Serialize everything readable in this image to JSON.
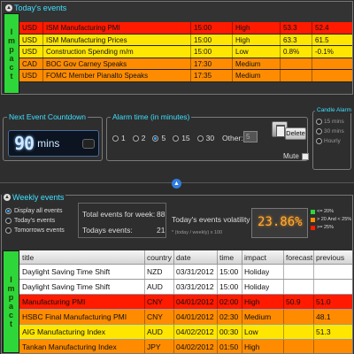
{
  "colors": {
    "high": "#ff1a00",
    "medium": "#ff8c00",
    "low": "#ffe600",
    "holiday": "#ffffff",
    "accent": "#3de0ff",
    "impact_strip": "#2fd63a"
  },
  "today": {
    "title": "Today's events",
    "impact_label": "Impact",
    "rows": [
      {
        "currency": "USD",
        "title": "ISM Manufacturing PMI",
        "time": "15:00",
        "impact": "High",
        "forecast": "53.3",
        "previous": "52.4",
        "level": "high"
      },
      {
        "currency": "USD",
        "title": "ISM Manufacturing Prices",
        "time": "15:00",
        "impact": "High",
        "forecast": "63.3",
        "previous": "61.5",
        "level": "low"
      },
      {
        "currency": "USD",
        "title": "Construction Spending m/m",
        "time": "15:00",
        "impact": "Low",
        "forecast": "0.8%",
        "previous": "-0.1%",
        "level": "low"
      },
      {
        "currency": "CAD",
        "title": "BOC Gov Carney Speaks",
        "time": "17:30",
        "impact": "Medium",
        "forecast": "",
        "previous": "",
        "level": "medium"
      },
      {
        "currency": "USD",
        "title": "FOMC Member Pianalto Speaks",
        "time": "17:35",
        "impact": "Medium",
        "forecast": "",
        "previous": "",
        "level": "medium"
      }
    ]
  },
  "countdown": {
    "title": "Next Event Countdown",
    "value": "90",
    "unit": "mins"
  },
  "alarm": {
    "title": "Alarm time (in minutes)",
    "options": [
      "1",
      "2",
      "5",
      "15",
      "30"
    ],
    "selected": "5",
    "other_label": "Other:",
    "other_value": "5",
    "delete_label": "Delete",
    "mute_label": "Mute"
  },
  "candle": {
    "title": "Candle Alarm",
    "options": [
      "15 mins",
      "30 mins",
      "Hourly"
    ]
  },
  "weekly": {
    "title": "Weekly events",
    "filters": [
      "Display all events",
      "Today's events",
      "Tomorrows events"
    ],
    "total_label": "Total events for week:",
    "total_value": "88",
    "today_label": "Todays events:",
    "today_value": "21",
    "volatility_label": "Today's events volatility * :",
    "volatility_sub": "* (today / weekly) x 100",
    "volatility_value": "23.86%",
    "legend": [
      "<= 20%",
      "> 20 And < 25%",
      ">= 25%"
    ],
    "impact_label": "Impact",
    "columns": [
      "title",
      "country",
      "date",
      "time",
      "impact",
      "forecast",
      "previous"
    ],
    "rows": [
      {
        "title": "Daylight Saving Time Shift",
        "country": "NZD",
        "date": "03/31/2012",
        "time": "15:00",
        "impact": "Holiday",
        "forecast": "",
        "previous": "",
        "level": "holiday"
      },
      {
        "title": "Daylight Saving Time Shift",
        "country": "AUD",
        "date": "03/31/2012",
        "time": "15:00",
        "impact": "Holiday",
        "forecast": "",
        "previous": "",
        "level": "holiday"
      },
      {
        "title": "Manufacturing PMI",
        "country": "CNY",
        "date": "04/01/2012",
        "time": "02:00",
        "impact": "High",
        "forecast": "50.9",
        "previous": "51.0",
        "level": "high"
      },
      {
        "title": "HSBC Final Manufacturing PMI",
        "country": "CNY",
        "date": "04/01/2012",
        "time": "02:30",
        "impact": "Medium",
        "forecast": "",
        "previous": "48.1",
        "level": "medium"
      },
      {
        "title": "AIG Manufacturing Index",
        "country": "AUD",
        "date": "04/02/2012",
        "time": "00:30",
        "impact": "Low",
        "forecast": "",
        "previous": "51.3",
        "level": "low"
      },
      {
        "title": "Tankan Manufacturing Index",
        "country": "JPY",
        "date": "04/02/2012",
        "time": "01:50",
        "impact": "High",
        "forecast": "",
        "previous": "",
        "level": "medium"
      }
    ]
  }
}
